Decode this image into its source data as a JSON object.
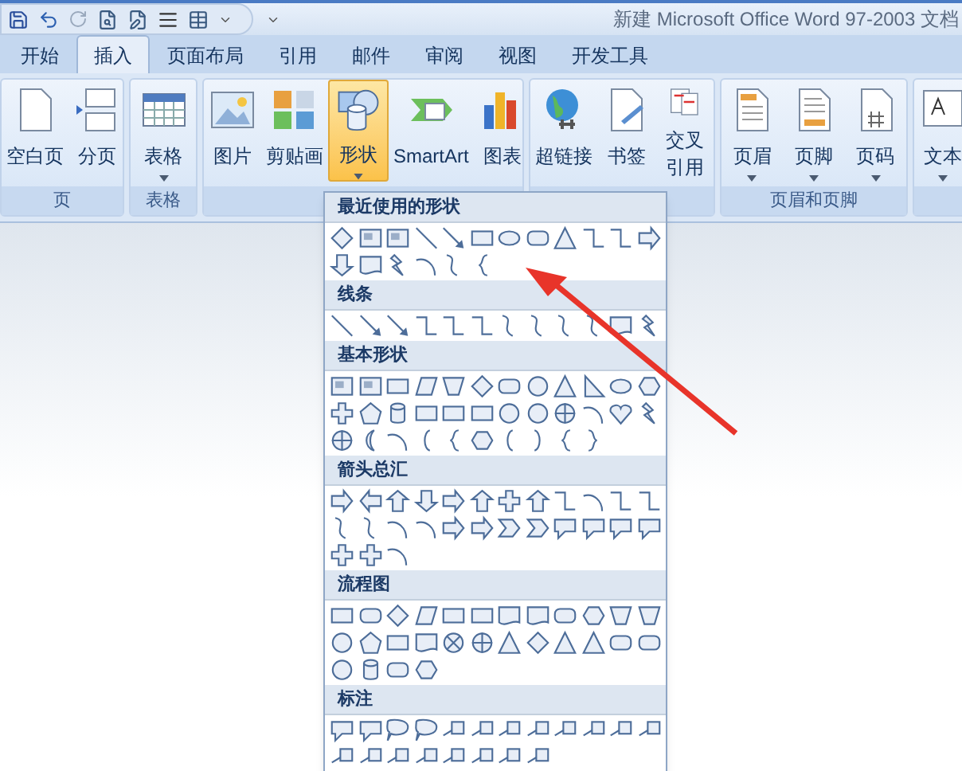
{
  "window": {
    "title": "新建 Microsoft Office Word 97-2003 文档"
  },
  "tabs": [
    {
      "label": "开始",
      "selected": false
    },
    {
      "label": "插入",
      "selected": true
    },
    {
      "label": "页面布局",
      "selected": false
    },
    {
      "label": "引用",
      "selected": false
    },
    {
      "label": "邮件",
      "selected": false
    },
    {
      "label": "审阅",
      "selected": false
    },
    {
      "label": "视图",
      "selected": false
    },
    {
      "label": "开发工具",
      "selected": false
    }
  ],
  "ribbon_groups": [
    {
      "label": "页",
      "buttons": [
        {
          "label": "空白页",
          "dropdown": false,
          "selected": false
        },
        {
          "label": "分页",
          "dropdown": false,
          "selected": false
        }
      ]
    },
    {
      "label": "表格",
      "buttons": [
        {
          "label": "表格",
          "dropdown": true,
          "selected": false
        }
      ]
    },
    {
      "buttons": [
        {
          "label": "图片",
          "dropdown": false,
          "selected": false
        },
        {
          "label": "剪贴画",
          "dropdown": false,
          "selected": false
        },
        {
          "label": "形状",
          "dropdown": true,
          "selected": true
        },
        {
          "label": "SmartArt",
          "dropdown": false,
          "selected": false
        },
        {
          "label": "图表",
          "dropdown": false,
          "selected": false
        }
      ]
    },
    {
      "buttons": [
        {
          "label": "超链接",
          "dropdown": false,
          "selected": false
        },
        {
          "label": "书签",
          "dropdown": false,
          "selected": false
        },
        {
          "label": [
            "交叉",
            "引用"
          ],
          "dropdown": false,
          "selected": false
        }
      ]
    },
    {
      "label": "页眉和页脚",
      "buttons": [
        {
          "label": "页眉",
          "dropdown": true,
          "selected": false
        },
        {
          "label": "页脚",
          "dropdown": true,
          "selected": false
        },
        {
          "label": "页码",
          "dropdown": true,
          "selected": false
        }
      ]
    },
    {
      "buttons": [
        {
          "label": "文本",
          "dropdown": true,
          "selected": false
        }
      ]
    }
  ],
  "shapes_menu": {
    "sections": [
      {
        "title": "最近使用的形状"
      },
      {
        "title": "线条"
      },
      {
        "title": "基本形状"
      },
      {
        "title": "箭头总汇"
      },
      {
        "title": "流程图"
      },
      {
        "title": "标注"
      }
    ]
  }
}
